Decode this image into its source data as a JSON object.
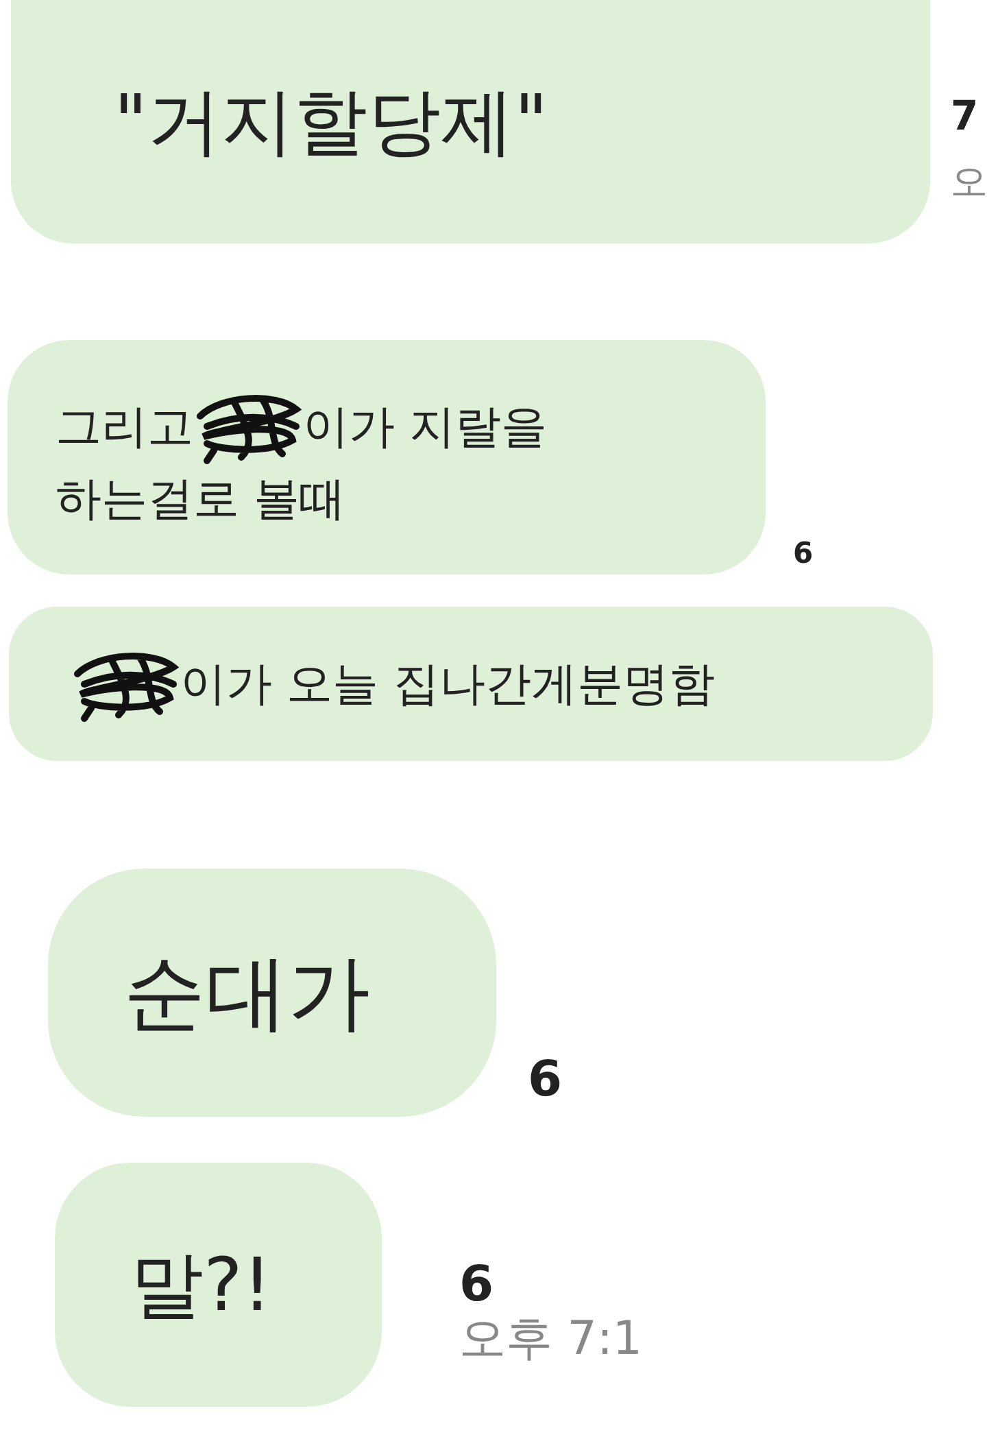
{
  "messages": [
    {
      "kind": "big",
      "lines": [
        [
          {
            "kind": "text",
            "text": "\"거지할당제\""
          }
        ]
      ],
      "side": [
        {
          "kind": "count",
          "text": "7"
        },
        {
          "kind": "time",
          "text": "오"
        }
      ]
    },
    {
      "kind": "normal",
      "lines": [
        [
          {
            "kind": "text",
            "text": "그리고"
          },
          {
            "kind": "redacted"
          },
          {
            "kind": "text",
            "text": "이가 지랄을"
          }
        ],
        [
          {
            "kind": "text",
            "text": "하는걸로 볼때"
          }
        ]
      ],
      "side": [
        {
          "kind": "count",
          "text": "6"
        }
      ]
    },
    {
      "kind": "normal",
      "lines": [
        [
          {
            "kind": "redacted"
          },
          {
            "kind": "text",
            "text": "이가 오늘 집나간게분명함"
          }
        ]
      ]
    },
    {
      "kind": "big",
      "lines": [
        [
          {
            "kind": "text",
            "text": "순대가"
          }
        ]
      ],
      "side": [
        {
          "kind": "count",
          "text": "6"
        }
      ]
    },
    {
      "kind": "big",
      "lines": [
        [
          {
            "kind": "text",
            "text": "말?!"
          }
        ]
      ],
      "side": [
        {
          "kind": "count",
          "text": "6"
        },
        {
          "kind": "time",
          "text": "오후 7:1"
        }
      ]
    }
  ]
}
